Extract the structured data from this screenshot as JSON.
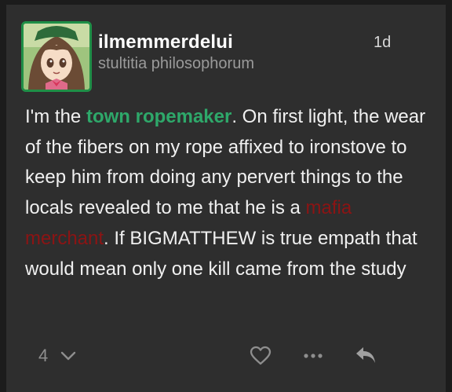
{
  "post": {
    "username": "ilmemmerdelui",
    "user_title": "stultitia philosophorum",
    "age": "1d",
    "body_before_green": "I'm the ",
    "body_green": "town ropemaker",
    "body_after_green": ". On first light, the wear of the fibers on my rope affixed to ironstove to keep him from doing any pervert things to the locals revealed to me that he is a ",
    "body_red": "mafia merchant",
    "body_after_red": ". If BIGMATTHEW is true empath that would mean only one kill came from the study",
    "colors": {
      "green_highlight": "#2ea86a",
      "red_highlight": "#8c1414",
      "avatar_border": "#1f8f47"
    }
  },
  "actions": {
    "likes_count": "4",
    "icons": [
      "chevron-down-icon",
      "heart-icon",
      "more-icon",
      "reply-icon"
    ]
  }
}
